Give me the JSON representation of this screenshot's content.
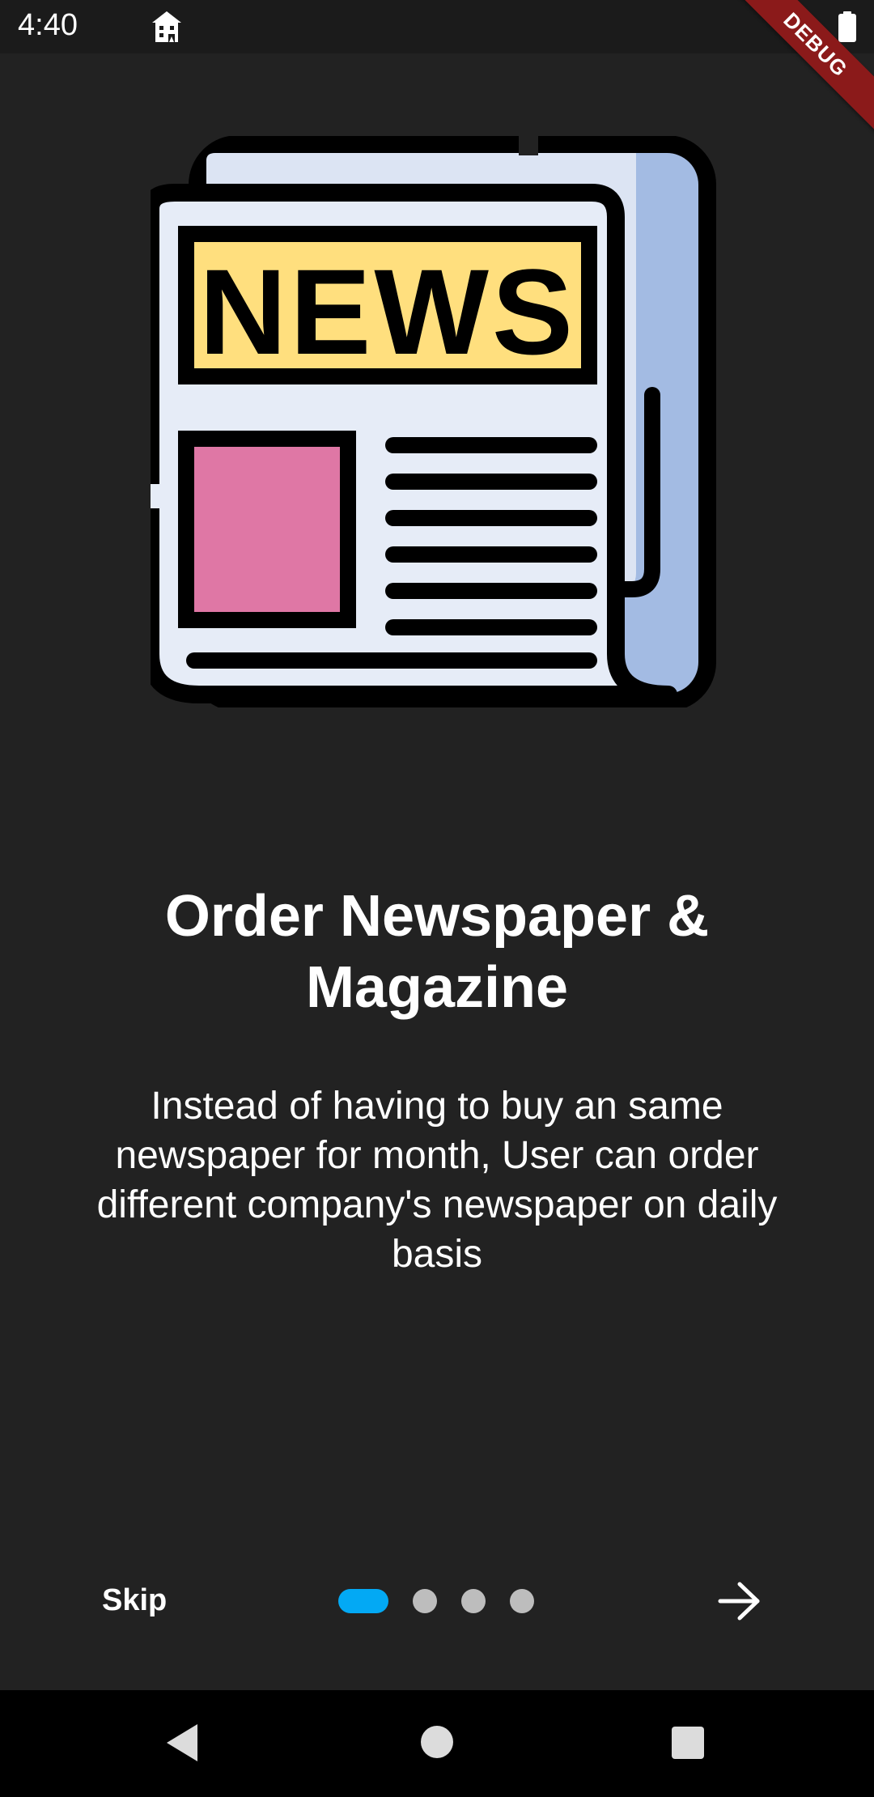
{
  "status_bar": {
    "time": "4:40",
    "app_icon": "house-building-icon",
    "battery_icon": "battery-full-icon"
  },
  "debug_banner": "DEBUG",
  "illustration": {
    "icon": "newspaper-icon",
    "masthead_text": "NEWS",
    "colors": {
      "masthead": "#ffdf7e",
      "photo_block": "#df77a5",
      "page": "#e6ecf7",
      "back_page": "#a3bbe3",
      "outline": "#000000"
    }
  },
  "onboarding": {
    "title_line1": "Order Newspaper &",
    "title_line2": "Magazine",
    "description": "Instead of having to buy an same newspaper for month, User can order different company's newspaper on daily basis",
    "skip_label": "Skip",
    "next_icon": "arrow-right-icon",
    "page_indicator": {
      "total": 4,
      "current": 1,
      "active_color": "#03a9f4",
      "inactive_color": "#bdbdbd"
    }
  },
  "nav_bar": {
    "back_icon": "triangle-back-icon",
    "home_icon": "circle-home-icon",
    "recents_icon": "square-recents-icon"
  }
}
